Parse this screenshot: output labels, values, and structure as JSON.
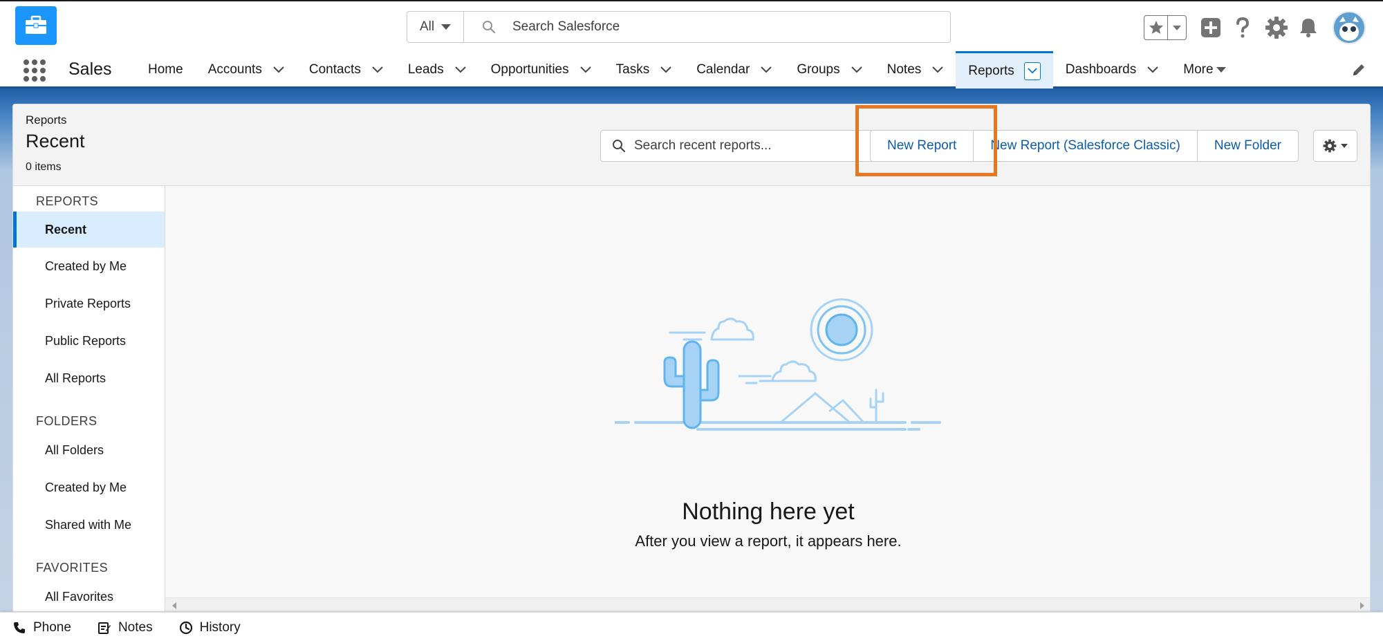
{
  "header": {
    "search_scope": "All",
    "search_placeholder": "Search Salesforce"
  },
  "nav": {
    "app_name": "Sales",
    "items": [
      {
        "label": "Home"
      },
      {
        "label": "Accounts"
      },
      {
        "label": "Contacts"
      },
      {
        "label": "Leads"
      },
      {
        "label": "Opportunities"
      },
      {
        "label": "Tasks"
      },
      {
        "label": "Calendar"
      },
      {
        "label": "Groups"
      },
      {
        "label": "Notes"
      },
      {
        "label": "Reports"
      },
      {
        "label": "Dashboards"
      }
    ],
    "more_label": "More"
  },
  "list_header": {
    "eyebrow": "Reports",
    "title": "Recent",
    "count": "0 items",
    "search_placeholder": "Search recent reports...",
    "buttons": {
      "new_report": "New Report",
      "new_report_classic": "New Report (Salesforce Classic)",
      "new_folder": "New Folder"
    }
  },
  "sidebar": {
    "sections": [
      {
        "title": "REPORTS",
        "items": [
          "Recent",
          "Created by Me",
          "Private Reports",
          "Public Reports",
          "All Reports"
        ]
      },
      {
        "title": "FOLDERS",
        "items": [
          "All Folders",
          "Created by Me",
          "Shared with Me"
        ]
      },
      {
        "title": "FAVORITES",
        "items": [
          "All Favorites"
        ]
      }
    ],
    "active": "Recent"
  },
  "empty_state": {
    "title": "Nothing here yet",
    "subtitle": "After you view a report, it appears here."
  },
  "utility_bar": {
    "items": [
      {
        "label": "Phone",
        "icon": "phone-icon"
      },
      {
        "label": "Notes",
        "icon": "notes-icon"
      },
      {
        "label": "History",
        "icon": "clock-icon"
      }
    ]
  },
  "colors": {
    "brand": "#0176d3",
    "highlight": "#e87722",
    "header_band": "#1f5da8"
  }
}
